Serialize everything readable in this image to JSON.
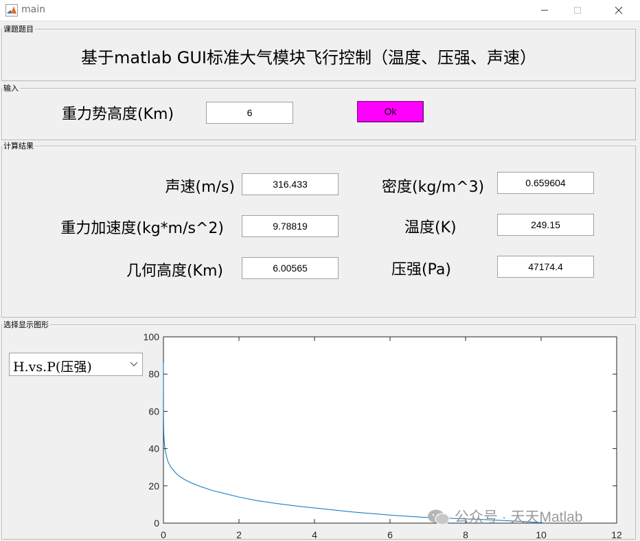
{
  "window": {
    "title": "main",
    "app_icon": "matlab-icon",
    "controls": [
      "minimize-icon",
      "maximize-icon",
      "close-icon"
    ]
  },
  "topic_panel": {
    "title": "课题题目",
    "text": "基于matlab GUI标准大气模块飞行控制（温度、压强、声速）"
  },
  "input_panel": {
    "title": "输入",
    "height_label": "重力势高度(Km)",
    "height_value": "6",
    "ok_label": "Ok",
    "ok_color": "#ff00ff"
  },
  "results_panel": {
    "title": "计算结果",
    "items": [
      {
        "label": "声速(m/s)",
        "value": "316.433"
      },
      {
        "label": "重力加速度(kg*m/s^2)",
        "value": "9.78819"
      },
      {
        "label": "几何高度(Km)",
        "value": "6.00565"
      },
      {
        "label": "密度(kg/m^3)",
        "value": "0.659604"
      },
      {
        "label": "温度(K)",
        "value": "249.15"
      },
      {
        "label": "压强(Pa)",
        "value": "47174.4"
      }
    ]
  },
  "plot_panel": {
    "title": "选择显示图形",
    "selector_value": "H.vs.P(压强)"
  },
  "chart_data": {
    "type": "line",
    "xlim": [
      0,
      12
    ],
    "ylim": [
      0,
      100
    ],
    "xticks": [
      "0",
      "2",
      "4",
      "6",
      "8",
      "10",
      "12"
    ],
    "yticks": [
      "0",
      "20",
      "40",
      "60",
      "80",
      "100"
    ],
    "grid": false,
    "line_color": "#0072bd",
    "series": [
      {
        "x": [
          0.0003,
          0.001,
          0.003,
          0.006,
          0.01,
          0.02,
          0.04,
          0.08,
          0.12,
          0.2,
          0.3,
          0.4,
          0.55,
          0.75,
          1.0,
          1.3,
          1.6,
          2.0,
          2.5,
          3.0,
          3.6,
          4.3,
          5.0,
          5.6,
          6.2,
          7.0,
          7.7,
          8.4,
          9.0,
          9.6,
          10.13
        ],
        "y": [
          86,
          70,
          58,
          52,
          48,
          44,
          40,
          36,
          33,
          30,
          27.5,
          25.5,
          23.5,
          21.5,
          19.5,
          17.5,
          16,
          14,
          12,
          10.5,
          9,
          7.5,
          6,
          5,
          4,
          3,
          2.5,
          2,
          1.4,
          0.8,
          0
        ]
      }
    ]
  },
  "watermark": {
    "icon": "wechat-icon",
    "text": "公众号 · 天天Matlab"
  }
}
